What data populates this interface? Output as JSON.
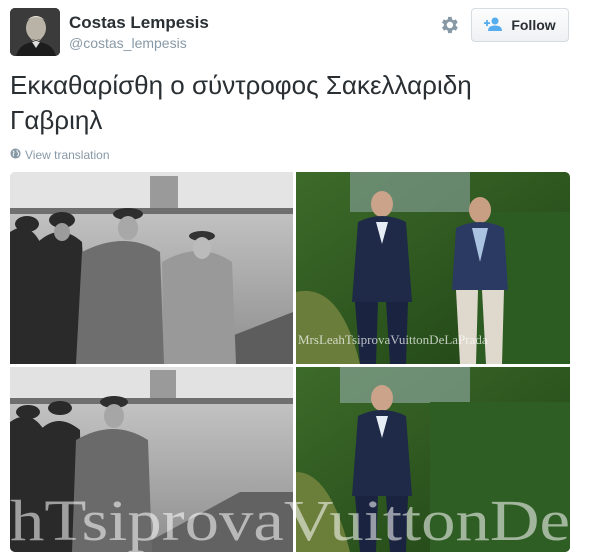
{
  "user": {
    "display_name": "Costas Lempesis",
    "handle": "@costas_lempesis"
  },
  "actions": {
    "follow_label": "Follow"
  },
  "tweet": {
    "text": "Εκκαθαρίσθη ο σύντροφος Σακελλαριδη Γαβριηλ",
    "view_translation": "View translation"
  },
  "media": {
    "watermark_top": "MrsLeahTsiprovaVuittonDeLaPrada",
    "watermark_bottom": "hTsiprovaVuittonDe"
  },
  "icons": {
    "settings": "gear-icon",
    "follow": "add-user-icon",
    "globe": "globe-icon"
  },
  "colors": {
    "name": "#292f33",
    "secondary": "#8899a6"
  }
}
